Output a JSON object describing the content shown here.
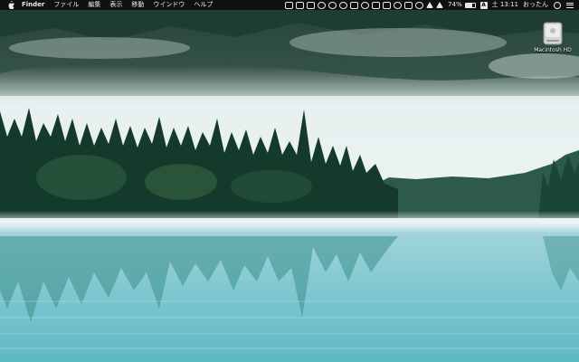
{
  "menubar": {
    "app_name": "Finder",
    "menus": [
      "ファイル",
      "編集",
      "表示",
      "移動",
      "ウインドウ",
      "ヘルプ"
    ],
    "status_icons": [
      "display-icon",
      "text-icon",
      "chat-icon",
      "s-icon",
      "info-icon",
      "d-icon",
      "clipboard-icon",
      "cloud-icon",
      "box-icon",
      "copy-icon",
      "eye-icon",
      "camera-icon",
      "time-machine-icon",
      "bluetooth-icon",
      "wifi-icon"
    ],
    "battery_percent": "74%",
    "battery_level": 0.74,
    "input_source_letter": "A",
    "clock": "土 13:11",
    "user_name": "おったん"
  },
  "desktop": {
    "drive_label": "Macintosh HD"
  },
  "colors": {
    "menubar_bg": "#101010",
    "lake": "#8ad3dc",
    "forest": "#143a2c",
    "fog": "#e6eff0"
  }
}
